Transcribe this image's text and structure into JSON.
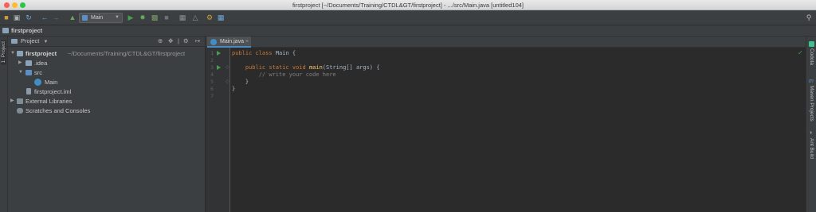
{
  "window": {
    "title": "firstproject [~/Documents/Training/CTDL&GT/firstproject] - .../src/Main.java [untitled104]"
  },
  "toolbar": {
    "run_config": "Main"
  },
  "nav": {
    "breadcrumb": "firstproject"
  },
  "left_strip": {
    "project_tab": "1: Project"
  },
  "project_panel": {
    "header": "Project",
    "root": {
      "name": "firstproject",
      "path": "~/Documents/Training/CTDL&GT/firstproject"
    },
    "items": [
      {
        "label": ".idea"
      },
      {
        "label": "src"
      },
      {
        "label": "Main"
      },
      {
        "label": "firstproject.iml"
      },
      {
        "label": "External Libraries"
      },
      {
        "label": "Scratches and Consoles"
      }
    ]
  },
  "editor": {
    "tab": "Main.java",
    "line_numbers": [
      "1",
      "2",
      "3",
      "4",
      "5",
      "6",
      "7"
    ],
    "lines": [
      {
        "kw": "public class ",
        "name": "Main",
        "rest": " {"
      },
      {
        "kw": "",
        "name": "",
        "rest": ""
      },
      {
        "kw": "    public static void ",
        "name": "main",
        "rest": "(String[] args) {"
      },
      {
        "kw": "",
        "name": "",
        "rest": "        // write your code here",
        "comment": true
      },
      {
        "kw": "",
        "name": "",
        "rest": "    }"
      },
      {
        "kw": "",
        "name": "",
        "rest": "}"
      },
      {
        "kw": "",
        "name": "",
        "rest": ""
      }
    ]
  },
  "right_strip": {
    "tools": [
      "Codota",
      "Maven Projects",
      "Ant Build"
    ]
  },
  "colors": {
    "keyword": "#cc7832",
    "method": "#ffc66d",
    "comment": "#808080",
    "run": "#499c54",
    "accent": "#4a88c7"
  }
}
